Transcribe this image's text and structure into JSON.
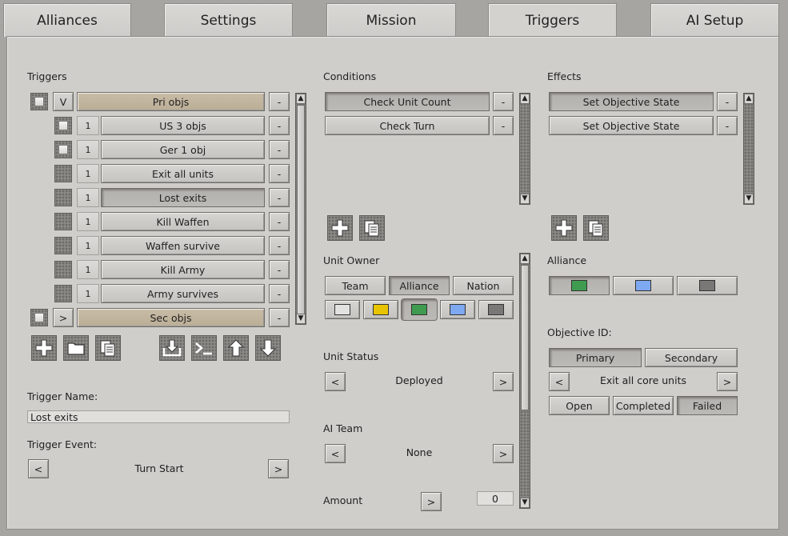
{
  "tabs": [
    "Alliances",
    "Settings",
    "Mission",
    "Triggers",
    "AI Setup"
  ],
  "triggers": {
    "label": "Triggers",
    "groups": {
      "primary": {
        "expand": "V",
        "label": "Pri objs"
      },
      "secondary": {
        "expand": ">",
        "label": "Sec objs"
      }
    },
    "items": [
      {
        "num": "1",
        "label": "US 3 objs"
      },
      {
        "num": "1",
        "label": "Ger 1 obj"
      },
      {
        "num": "1",
        "label": "Exit all units"
      },
      {
        "num": "1",
        "label": "Lost exits"
      },
      {
        "num": "1",
        "label": "Kill Waffen"
      },
      {
        "num": "1",
        "label": "Waffen survive"
      },
      {
        "num": "1",
        "label": "Kill Army"
      },
      {
        "num": "1",
        "label": "Army survives"
      }
    ],
    "remove_label": "-",
    "trigger_name_label": "Trigger Name:",
    "trigger_name_value": "Lost exits",
    "trigger_event_label": "Trigger Event:",
    "trigger_event_value": "Turn Start",
    "prev": "<",
    "next": ">"
  },
  "conditions": {
    "label": "Conditions",
    "items": [
      "Check Unit Count",
      "Check Turn"
    ],
    "remove_label": "-",
    "unit_owner_label": "Unit Owner",
    "owner_modes": [
      "Team",
      "Alliance",
      "Nation"
    ],
    "owner_colors": [
      "#e2e2e0",
      "#e8c400",
      "#3f9b4f",
      "#7ea8ef",
      "#7a7876"
    ],
    "unit_status_label": "Unit Status",
    "unit_status_value": "Deployed",
    "ai_team_label": "AI Team",
    "ai_team_value": "None",
    "amount_label": "Amount",
    "amount_value": "0",
    "prev": "<",
    "next": ">"
  },
  "effects": {
    "label": "Effects",
    "items": [
      "Set Objective State",
      "Set Objective State"
    ],
    "remove_label": "-",
    "alliance_label": "Alliance",
    "alliance_colors": [
      "#3f9b4f",
      "#7ea8ef",
      "#7a7876"
    ],
    "objective_id_label": "Objective ID:",
    "objective_types": [
      "Primary",
      "Secondary"
    ],
    "objective_value": "Exit all core units",
    "states": [
      "Open",
      "Completed",
      "Failed"
    ],
    "prev": "<",
    "next": ">"
  },
  "scroll": {
    "up": "▲",
    "down": "▼"
  }
}
